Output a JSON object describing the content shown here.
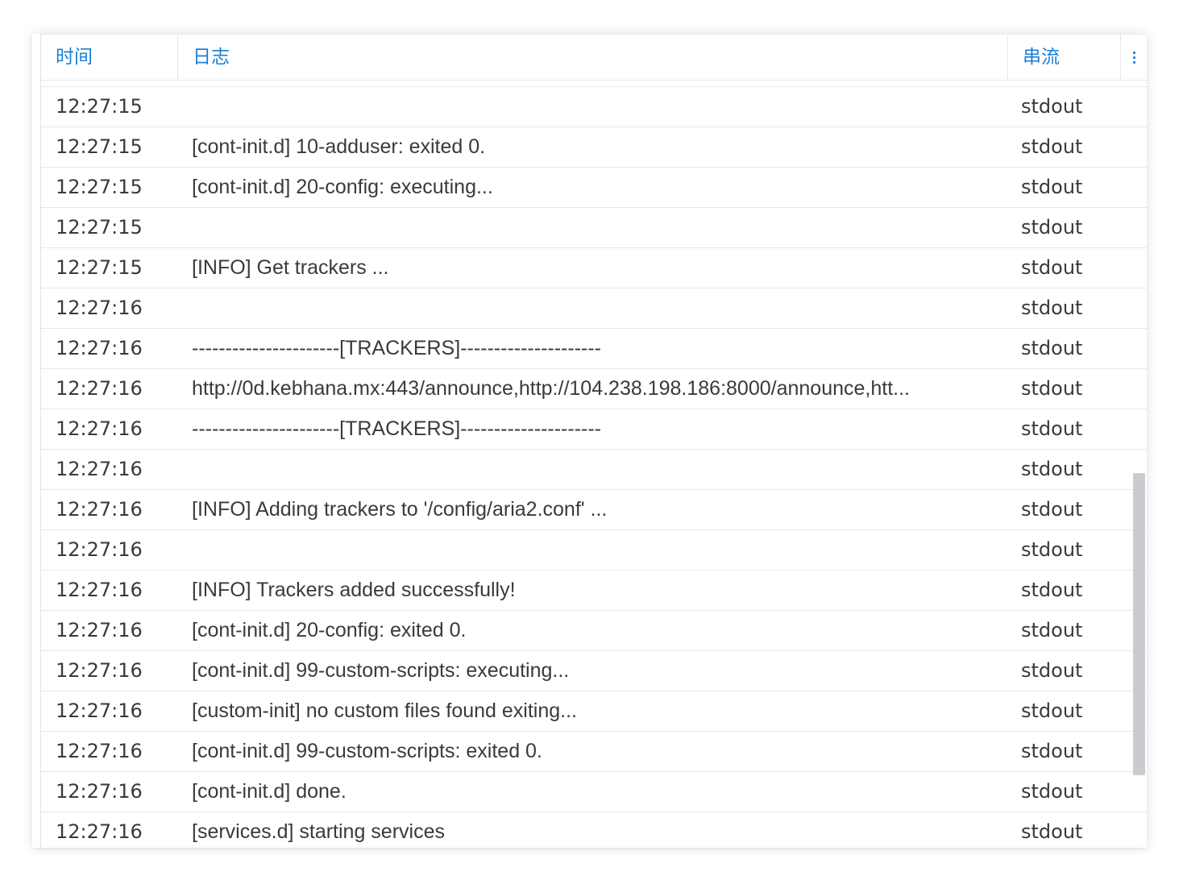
{
  "header": {
    "time": "时间",
    "log": "日志",
    "stream": "串流"
  },
  "menu_icon": "more-vertical-icon",
  "rows": [
    {
      "time": "12:27:15",
      "log": "",
      "stream": "stdout"
    },
    {
      "time": "12:27:15",
      "log": "[cont-init.d] 10-adduser: exited 0.",
      "stream": "stdout"
    },
    {
      "time": "12:27:15",
      "log": "[cont-init.d] 20-config: executing...",
      "stream": "stdout"
    },
    {
      "time": "12:27:15",
      "log": "",
      "stream": "stdout"
    },
    {
      "time": "12:27:15",
      "log": "[INFO] Get trackers ...",
      "stream": "stdout"
    },
    {
      "time": "12:27:16",
      "log": "",
      "stream": "stdout"
    },
    {
      "time": "12:27:16",
      "log": "----------------------[TRACKERS]---------------------",
      "stream": "stdout"
    },
    {
      "time": "12:27:16",
      "log": "http://0d.kebhana.mx:443/announce,http://104.238.198.186:8000/announce,htt...",
      "stream": "stdout"
    },
    {
      "time": "12:27:16",
      "log": "----------------------[TRACKERS]---------------------",
      "stream": "stdout"
    },
    {
      "time": "12:27:16",
      "log": "",
      "stream": "stdout"
    },
    {
      "time": "12:27:16",
      "log": "[INFO] Adding trackers to '/config/aria2.conf' ...",
      "stream": "stdout"
    },
    {
      "time": "12:27:16",
      "log": "",
      "stream": "stdout"
    },
    {
      "time": "12:27:16",
      "log": "[INFO] Trackers added successfully!",
      "stream": "stdout"
    },
    {
      "time": "12:27:16",
      "log": "[cont-init.d] 20-config: exited 0.",
      "stream": "stdout"
    },
    {
      "time": "12:27:16",
      "log": "[cont-init.d] 99-custom-scripts: executing...",
      "stream": "stdout"
    },
    {
      "time": "12:27:16",
      "log": "[custom-init] no custom files found exiting...",
      "stream": "stdout"
    },
    {
      "time": "12:27:16",
      "log": "[cont-init.d] 99-custom-scripts: exited 0.",
      "stream": "stdout"
    },
    {
      "time": "12:27:16",
      "log": "[cont-init.d] done.",
      "stream": "stdout"
    },
    {
      "time": "12:27:16",
      "log": "[services.d] starting services",
      "stream": "stdout"
    }
  ],
  "colors": {
    "accent": "#1a7ed6",
    "text": "#3a3a3a",
    "divider": "#e4e7eb",
    "scrollbar": "#c9cbcf"
  }
}
